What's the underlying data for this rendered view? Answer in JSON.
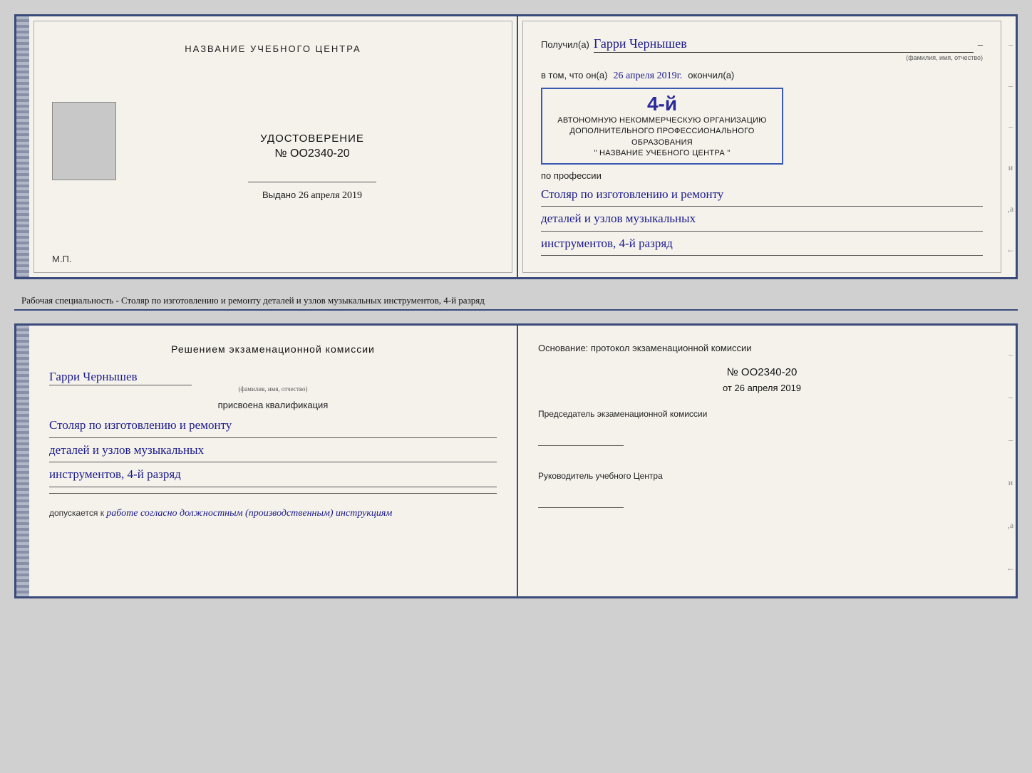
{
  "top_doc": {
    "left": {
      "center_title": "НАЗВАНИЕ УЧЕБНОГО ЦЕНТРА",
      "photo_label": "фото",
      "cert_type": "УДОСТОВЕРЕНИЕ",
      "cert_number": "№ OO2340-20",
      "issued_label": "Выдано",
      "issued_date": "26 апреля 2019",
      "mp_label": "М.П."
    },
    "right": {
      "received_label": "Получил(а)",
      "recipient_name": "Гарри Чернышев",
      "name_sub": "(фамилия, имя, отчество)",
      "in_that_label": "в том, что он(а)",
      "completion_date": "26 апреля 2019г.",
      "finished_label": "окончил(а)",
      "stamp_line1": "4-й",
      "org_line1": "АВТОНОМНУЮ НЕКОММЕРЧЕСКУЮ ОРГАНИЗАЦИЮ",
      "org_line2": "ДОПОЛНИТЕЛЬНОГО ПРОФЕССИОНАЛЬНОГО ОБРАЗОВАНИЯ",
      "org_line3": "\" НАЗВАНИЕ УЧЕБНОГО ЦЕНТРА \"",
      "profession_label": "по профессии",
      "profession_line1": "Столяр по изготовлению и ремонту",
      "profession_line2": "деталей и узлов музыкальных",
      "profession_line3": "инструментов, 4-й разряд",
      "dash1": "–",
      "dash2": "–",
      "dash3": "–",
      "dash4": "–",
      "side_and": "и",
      "side_a": ",а",
      "side_arrow": "←"
    }
  },
  "specialty_label": "Рабочая специальность - Столяр по изготовлению и ремонту деталей и узлов музыкальных инструментов, 4-й разряд",
  "bottom_doc": {
    "left": {
      "decision_title": "Решением экзаменационной комиссии",
      "recipient_name": "Гарри Чернышев",
      "name_sub": "(фамилия, имя, отчество)",
      "qual_label": "присвоена квалификация",
      "qual_line1": "Столяр по изготовлению и ремонту",
      "qual_line2": "деталей и узлов музыкальных",
      "qual_line3": "инструментов, 4-й разряд",
      "allowed_label": "допускается к",
      "allowed_text": "работе согласно должностным (производственным) инструкциям"
    },
    "right": {
      "basis_label": "Основание: протокол экзаменационной комиссии",
      "protocol_number": "№  OO2340-20",
      "protocol_date_prefix": "от",
      "protocol_date": "26 апреля 2019",
      "chairman_label": "Председатель экзаменационной комиссии",
      "director_label": "Руководитель учебного Центра",
      "dash1": "–",
      "dash2": "–",
      "dash3": "–",
      "side_and": "и",
      "side_a": ",а",
      "side_arrow": "←"
    }
  }
}
